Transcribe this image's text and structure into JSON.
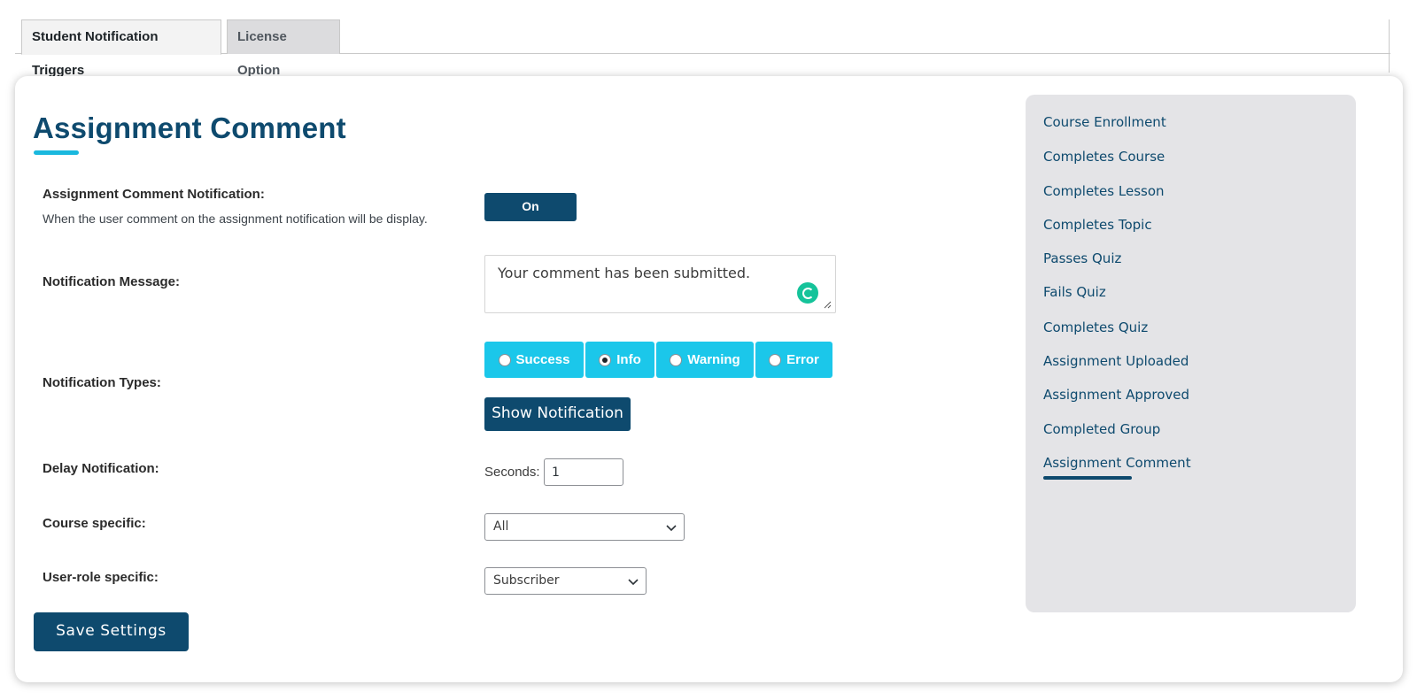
{
  "tabs": [
    {
      "label": "Student Notification Triggers",
      "active": true
    },
    {
      "label": "License Option",
      "active": false
    }
  ],
  "main": {
    "title": "Assignment Comment",
    "notification": {
      "label": "Assignment Comment Notification:",
      "description": "When the user comment on the assignment notification will be display.",
      "toggle_label": "On"
    },
    "message": {
      "label": "Notification Message:",
      "value": "Your comment has been submitted."
    },
    "types": {
      "label": "Notification Types:",
      "options": [
        {
          "label": "Success",
          "checked": false
        },
        {
          "label": "Info",
          "checked": true
        },
        {
          "label": "Warning",
          "checked": false
        },
        {
          "label": "Error",
          "checked": false
        }
      ],
      "show_button": "Show Notification"
    },
    "delay": {
      "label": "Delay Notification:",
      "seconds_label": "Seconds:",
      "value": "1"
    },
    "course": {
      "label": "Course specific:",
      "selected": "All"
    },
    "role": {
      "label": "User-role specific:",
      "selected": "Subscriber"
    },
    "save_label": "Save Settings"
  },
  "sidebar": {
    "items": [
      "Course Enrollment",
      "Completes Course",
      "Completes Lesson",
      "Completes Topic",
      "Passes Quiz",
      "Fails Quiz",
      "Completes Quiz",
      "Assignment Uploaded",
      "Assignment Approved",
      "Completed Group",
      "Assignment Comment"
    ],
    "active_item": "Assignment Comment"
  },
  "icons": {
    "grammarly": "grammarly-icon",
    "resize": "resize-handle-icon",
    "chevron": "chevron-down-icon"
  },
  "colors": {
    "primary": "#0e4a6e",
    "accent": "#1bc7ea",
    "sidebar_bg": "#e4e4e7"
  }
}
